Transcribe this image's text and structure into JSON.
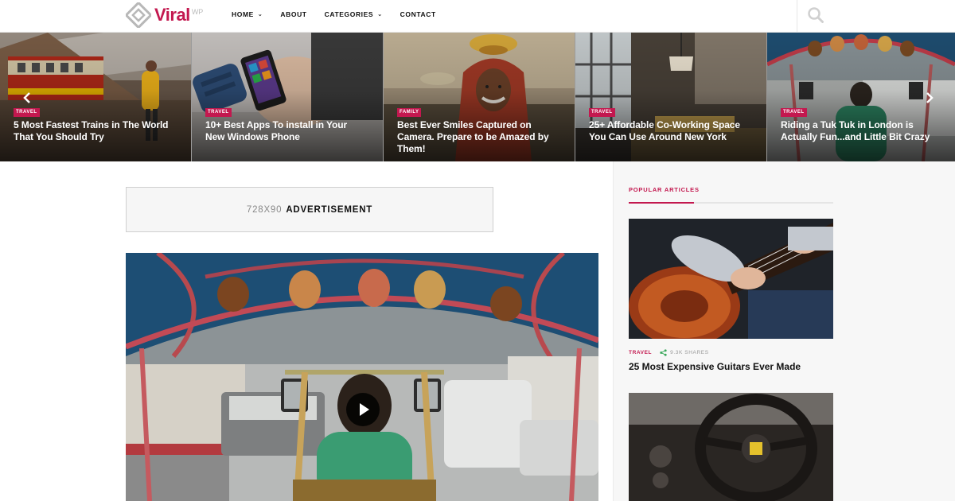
{
  "brand": {
    "name": "Viral",
    "suffix": "WP",
    "accent": "#c3184f"
  },
  "nav": {
    "items": [
      {
        "label": "HOME",
        "has_dropdown": true
      },
      {
        "label": "ABOUT",
        "has_dropdown": false
      },
      {
        "label": "CATEGORIES",
        "has_dropdown": true
      },
      {
        "label": "CONTACT",
        "has_dropdown": false
      }
    ],
    "search_icon": "search-icon"
  },
  "slider": {
    "prev_icon": "chevron-left-icon",
    "next_icon": "chevron-right-icon",
    "slides": [
      {
        "tag": "TRAVEL",
        "title": "5 Most Fastest Trains in The World That You Should Try"
      },
      {
        "tag": "TRAVEL",
        "title": "10+ Best Apps To install in Your New Windows Phone"
      },
      {
        "tag": "FAMILY",
        "title": "Best Ever Smiles Captured on Camera. Prepare to be Amazed by Them!"
      },
      {
        "tag": "TRAVEL",
        "title": "25+ Affordable Co-Working Space You Can Use Around New York"
      },
      {
        "tag": "TRAVEL",
        "title": "Riding a Tuk Tuk in London is Actually Fun...and Little Bit Crazy"
      }
    ]
  },
  "advertisement": {
    "size": "728X90",
    "label": "ADVERTISEMENT"
  },
  "feature": {
    "play_icon": "play-icon"
  },
  "sidebar": {
    "heading": "POPULAR ARTICLES",
    "articles": [
      {
        "category": "TRAVEL",
        "shares": "9.3K SHARES",
        "title": "25 Most Expensive Guitars Ever Made"
      }
    ]
  }
}
